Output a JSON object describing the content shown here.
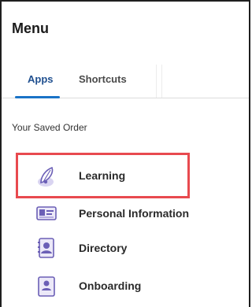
{
  "menu": {
    "title": "Menu"
  },
  "tabs": [
    {
      "label": "Apps"
    },
    {
      "label": "Shortcuts"
    }
  ],
  "section": {
    "label": "Your Saved Order"
  },
  "apps": [
    {
      "label": "Learning",
      "icon": "learning-icon"
    },
    {
      "label": "Personal Information",
      "icon": "id-card-icon"
    },
    {
      "label": "Directory",
      "icon": "directory-book-icon"
    },
    {
      "label": "Onboarding",
      "icon": "onboarding-icon"
    }
  ],
  "colors": {
    "accent": "#1a73c7",
    "active_tab": "#1f4f8f",
    "highlight": "#e84a4f",
    "icon_purple": "#6b5fb6"
  }
}
